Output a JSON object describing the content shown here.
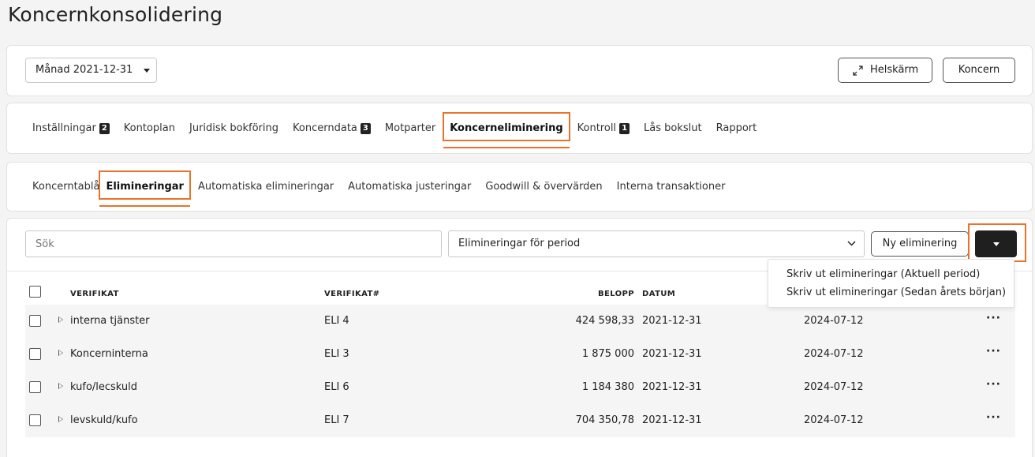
{
  "page": {
    "title": "Koncernkonsolidering"
  },
  "header": {
    "period_select": "Månad 2021-12-31",
    "fullscreen_label": "Helskärm",
    "koncern_label": "Koncern"
  },
  "main_tabs": [
    {
      "label": "Inställningar",
      "badge": "2"
    },
    {
      "label": "Kontoplan",
      "badge": ""
    },
    {
      "label": "Juridisk bokföring",
      "badge": ""
    },
    {
      "label": "Koncerndata",
      "badge": "3"
    },
    {
      "label": "Motparter",
      "badge": ""
    },
    {
      "label": "Koncerneliminering",
      "badge": "",
      "active": true
    },
    {
      "label": "Kontroll",
      "badge": "1"
    },
    {
      "label": "Lås bokslut",
      "badge": ""
    },
    {
      "label": "Rapport",
      "badge": ""
    }
  ],
  "sub_tabs": [
    {
      "label": "Koncerntablå"
    },
    {
      "label": "Elimineringar",
      "active": true
    },
    {
      "label": "Automatiska elimineringar"
    },
    {
      "label": "Automatiska justeringar"
    },
    {
      "label": "Goodwill & övervärden"
    },
    {
      "label": "Interna transaktioner"
    }
  ],
  "toolbar": {
    "search_placeholder": "Sök",
    "period_filter": "Elimineringar för period",
    "new_label": "Ny eliminering"
  },
  "dropdown_menu": {
    "items": [
      "Skriv ut elimineringar (Aktuell period)",
      "Skriv ut elimineringar (Sedan årets början)"
    ]
  },
  "table": {
    "headers": {
      "verifikat": "VERIFIKAT",
      "verifikat_no": "VERIFIKAT#",
      "belopp": "BELOPP",
      "datum": "DATUM"
    },
    "rows": [
      {
        "name": "interna tjänster",
        "ver": "ELI 4",
        "amount": "424 598,33",
        "date": "2021-12-31",
        "date2": "2024-07-12",
        "more": "···"
      },
      {
        "name": "Koncerninterna",
        "ver": "ELI 3",
        "amount": "1 875 000",
        "date": "2021-12-31",
        "date2": "2024-07-12",
        "more": "···"
      },
      {
        "name": "kufo/lecskuld",
        "ver": "ELI 6",
        "amount": "1 184 380",
        "date": "2021-12-31",
        "date2": "2024-07-12",
        "more": "···"
      },
      {
        "name": "levskuld/kufo",
        "ver": "ELI 7",
        "amount": "704 350,78",
        "date": "2021-12-31",
        "date2": "2024-07-12",
        "more": "···"
      }
    ]
  },
  "colors": {
    "accent": "#e8732a",
    "dark_button": "#1f1f1f"
  }
}
